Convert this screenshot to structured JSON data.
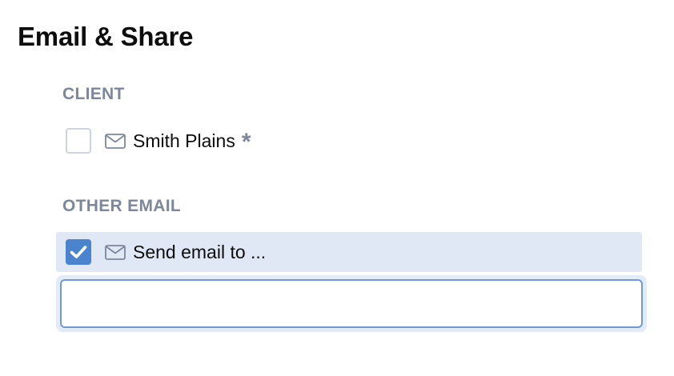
{
  "header": {
    "title": "Email & Share"
  },
  "client_section": {
    "heading": "CLIENT",
    "recipient": {
      "label": "Smith Plains",
      "required_marker": "*",
      "checked": false,
      "icon": "mail-icon"
    }
  },
  "other_section": {
    "heading": "OTHER EMAIL",
    "option": {
      "label": "Send email to ...",
      "checked": true,
      "icon": "mail-icon"
    },
    "email_input": {
      "value": "",
      "placeholder": ""
    }
  },
  "colors": {
    "accent": "#4a84cf",
    "section_label": "#7d879c",
    "selected_row_bg": "#dfe8f4",
    "input_border": "#6f9ad6"
  }
}
